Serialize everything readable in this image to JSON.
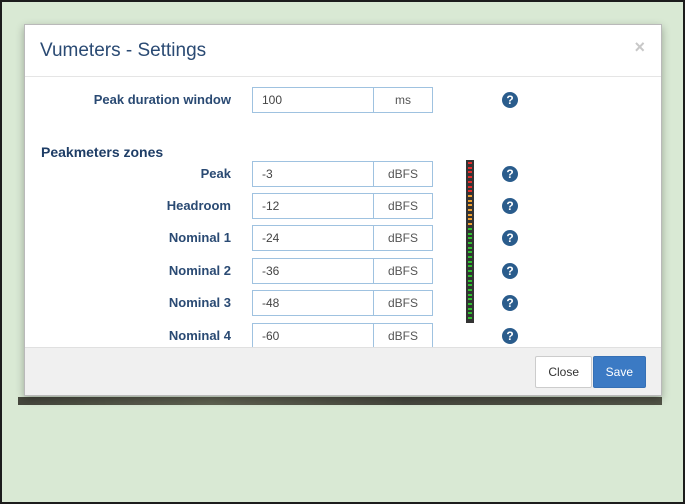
{
  "dialog": {
    "title": "Vumeters - Settings",
    "close_symbol": "×"
  },
  "peak_duration": {
    "label": "Peak duration window",
    "value": "100",
    "unit": "ms"
  },
  "zones": {
    "section_label": "Peakmeters zones",
    "items": [
      {
        "label": "Peak",
        "value": "-3",
        "unit": "dBFS"
      },
      {
        "label": "Headroom",
        "value": "-12",
        "unit": "dBFS"
      },
      {
        "label": "Nominal 1",
        "value": "-24",
        "unit": "dBFS"
      },
      {
        "label": "Nominal 2",
        "value": "-36",
        "unit": "dBFS"
      },
      {
        "label": "Nominal 3",
        "value": "-48",
        "unit": "dBFS"
      },
      {
        "label": "Nominal 4",
        "value": "-60",
        "unit": "dBFS"
      }
    ]
  },
  "help_symbol": "?",
  "meter": {
    "colors": {
      "peak": "#e52b2b",
      "headroom": "#f0a030",
      "nominal": "#2fbf2f"
    },
    "segments": {
      "peak": 7,
      "headroom": 7,
      "nominal": 20
    }
  },
  "footer": {
    "close_label": "Close",
    "save_label": "Save"
  }
}
